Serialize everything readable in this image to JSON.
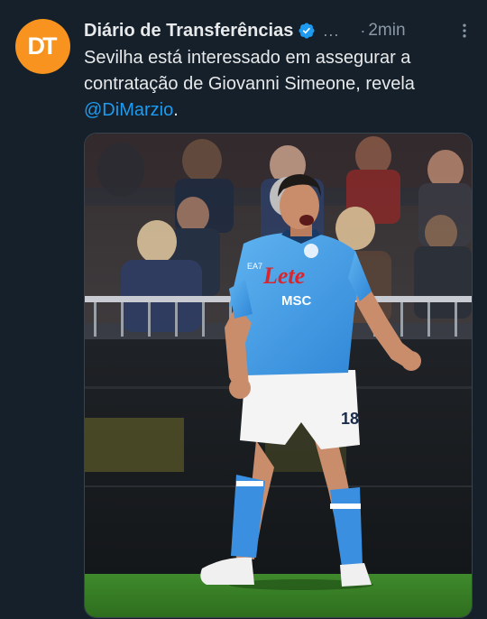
{
  "tweet": {
    "display_name": "Diário de Transferências",
    "avatar_initials": "DT",
    "ellipsis": "...",
    "separator": "·",
    "timestamp": "2min",
    "text_part1": "Sevilha está interessado em assegurar a contratação de Giovanni Simeone, revela ",
    "mention": "@DiMarzio",
    "text_end": ".",
    "icons": {
      "verified": "verified-badge-icon",
      "more": "more-options-icon"
    },
    "media": {
      "jersey_sponsor": "Lete",
      "jersey_partner": "MSC",
      "kit_brand": "EA7",
      "shirt_number": "18"
    }
  },
  "colors": {
    "background": "#15202b",
    "text": "#e7e9ea",
    "secondary": "#8b98a5",
    "link": "#1d9bf0",
    "verified": "#1d9bf0",
    "avatar": "#f7931e"
  }
}
